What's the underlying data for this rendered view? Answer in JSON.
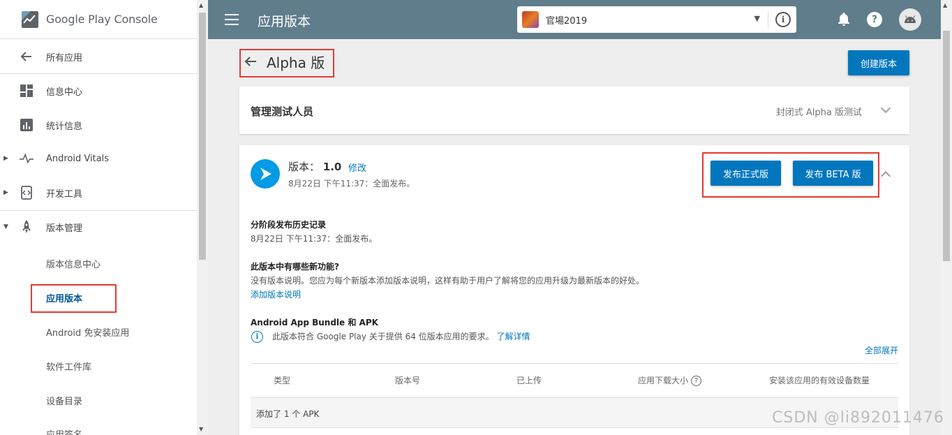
{
  "sidebar": {
    "logo_text": "Google Play Console",
    "items": [
      {
        "label": "所有应用",
        "icon": "arrow-back-icon"
      },
      {
        "label": "信息中心",
        "icon": "dashboard-icon"
      },
      {
        "label": "统计信息",
        "icon": "bar-chart-icon"
      },
      {
        "label": "Android Vitals",
        "icon": "vitals-pulse-icon"
      },
      {
        "label": "开发工具",
        "icon": "dev-tools-icon"
      },
      {
        "label": "版本管理",
        "icon": "rocket-icon"
      }
    ],
    "sub_items": [
      "版本信息中心",
      "应用版本",
      "Android 免安装应用",
      "软件工件库",
      "设备目录",
      "应用签名"
    ]
  },
  "header": {
    "title": "应用版本",
    "app_name": "官場2019"
  },
  "page": {
    "back_title": "Alpha 版",
    "create_button": "创建版本",
    "testers_card": {
      "title": "管理测试人员",
      "status": "封闭式 Alpha 版测试"
    },
    "release": {
      "version_label": "版本：",
      "version_number": "1.0",
      "edit_link": "修改",
      "date": "8月22日 下午11:37：全面发布。",
      "promote_production": "发布正式版",
      "promote_beta": "发布 BETA 版",
      "history_title": "分阶段发布历史记录",
      "history_text": "8月22日 下午11:37：全面发布。",
      "whats_new_title": "此版本中有哪些新功能?",
      "whats_new_text": "没有版本说明。您应为每个新版本添加版本说明，这样有助于用户了解将您的应用升级为最新版本的好处。",
      "add_notes_link": "添加版本说明",
      "bundle_title": "Android App Bundle 和 APK",
      "bundle_info": "此版本符合 Google Play 关于提供 64 位版本应用的要求。",
      "learn_more": "了解详情",
      "expand_all": "全部展开",
      "table_headers": [
        "类型",
        "版本号",
        "已上传",
        "应用下载大小",
        "安装该应用的有效设备数量"
      ],
      "table_row": "添加了 1 个 APK"
    }
  },
  "watermark": "CSDN @li892011476",
  "colors": {
    "header_bg": "#607d8b",
    "primary_button": "#0277bd",
    "highlight_box": "#e53935"
  }
}
